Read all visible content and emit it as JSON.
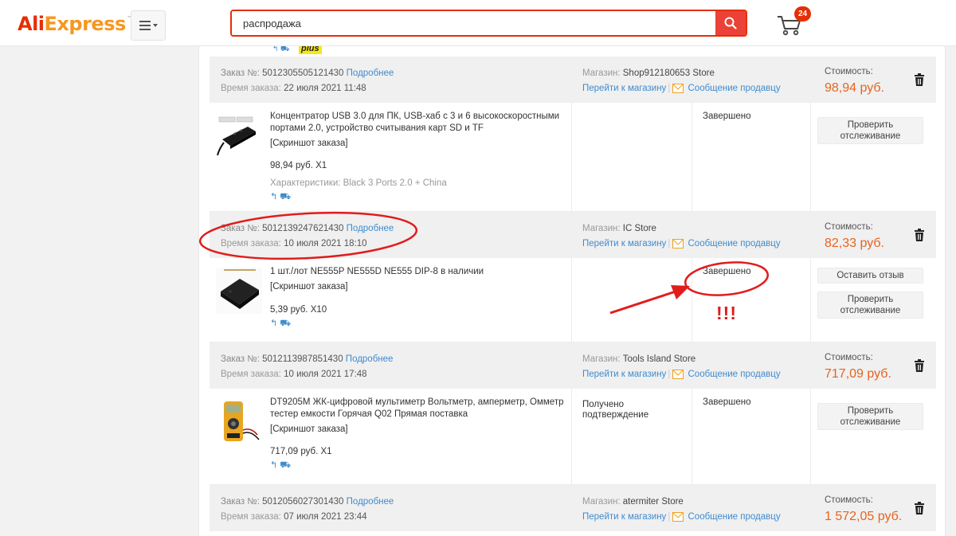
{
  "header": {
    "logo_part1": "Ali",
    "logo_part2": "Express",
    "logo_tm": "™",
    "search": {
      "value": "распродажа"
    },
    "cart_count": "24"
  },
  "prev_fragment": {
    "plus_label": "plus"
  },
  "labels": {
    "order_no": "Заказ №:",
    "order_time": "Время заказа:",
    "details": "Подробнее",
    "store": "Магазин:",
    "go_to_store": "Перейти к магазину",
    "message_seller": "Сообщение продавцу",
    "cost": "Стоимость:",
    "screenshot": "[Скриншот заказа]",
    "characteristics": "Характеристики:",
    "check_tracking": "Проверить отслеживание",
    "leave_review": "Оставить отзыв"
  },
  "orders": [
    {
      "number": "5012305505121430",
      "time": "22 июля 2021 11:48",
      "store": "Shop912180653 Store",
      "cost": "98,94 руб.",
      "product": {
        "title": "Концентратор USB 3.0 для ПК, USB-хаб с 3 и 6 высокоскоростными портами 2.0, устройство считывания карт SD и TF",
        "qty": "98,94 руб. X1",
        "characteristics": "Black 3 Ports 2.0 + China"
      },
      "shipping": "",
      "status": "Завершено"
    },
    {
      "number": "5012139247621430",
      "time": "10 июля 2021 18:10",
      "store": "IC Store",
      "cost": "82,33 руб.",
      "product": {
        "title": "1 шт./лот NE555P NE555D NE555 DIP-8 в наличии",
        "qty": "5,39 руб. X10"
      },
      "shipping": "",
      "status": "Завершено"
    },
    {
      "number": "5012113987851430",
      "time": "10 июля 2021 17:48",
      "store": "Tools Island Store",
      "cost": "717,09 руб.",
      "product": {
        "title": "DT9205M ЖК-цифровой мультиметр Вольтметр, амперметр, Омметр тестер емкости Горячая Q02 Прямая поставка",
        "qty": "717,09 руб. X1"
      },
      "shipping": "Получено подтверждение",
      "status": "Завершено"
    },
    {
      "number": "5012056027301430",
      "time": "07 июля 2021 23:44",
      "store": "atermiter Store",
      "cost": "1 572,05 руб."
    }
  ],
  "annotation": {
    "marks": "!!!",
    "color": "#e21c1c"
  },
  "colors": {
    "brand": "#e62e04",
    "price": "#e5641e",
    "link": "#3f8bcd"
  }
}
